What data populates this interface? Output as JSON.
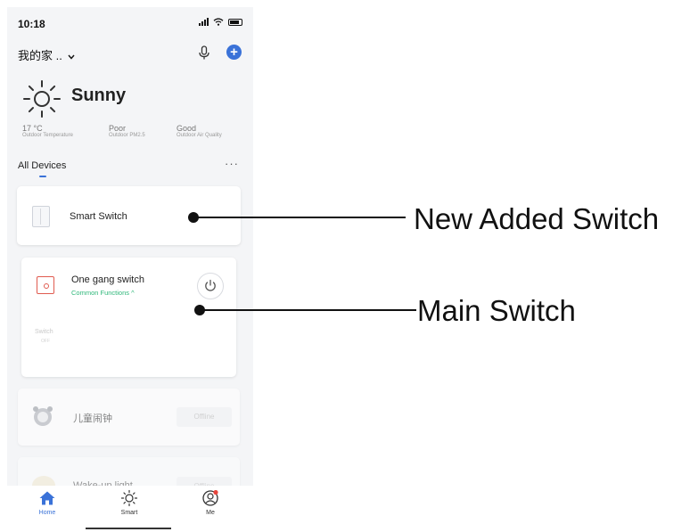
{
  "status_bar": {
    "time": "10:18"
  },
  "header": {
    "home_name": "我的家 .."
  },
  "weather": {
    "condition": "Sunny",
    "stats": [
      {
        "value": "17 °C",
        "label": "Outdoor Temperature"
      },
      {
        "value": "Poor",
        "label": "Outdoor PM2.5"
      },
      {
        "value": "Good",
        "label": "Outdoor Air Quality"
      }
    ]
  },
  "devices_header": {
    "title": "All Devices",
    "more": "···"
  },
  "devices": [
    {
      "name": "Smart Switch"
    },
    {
      "name": "One gang switch",
      "sub": "Common Functions ^",
      "switch_label": "Switch",
      "switch_state": "OFF"
    },
    {
      "name": "儿童闹钟",
      "status": "Offline"
    },
    {
      "name": "Wake-up light",
      "status": "Offline"
    }
  ],
  "nav": [
    {
      "label": "Home",
      "active": true
    },
    {
      "label": "Smart",
      "active": false
    },
    {
      "label": "Me",
      "active": false
    }
  ],
  "callouts": {
    "new_added": "New Added Switch",
    "main": "Main Switch"
  },
  "colors": {
    "accent": "#3a72d8",
    "green": "#2fb77a",
    "red": "#e05b4f",
    "badge": "#e8453c"
  }
}
